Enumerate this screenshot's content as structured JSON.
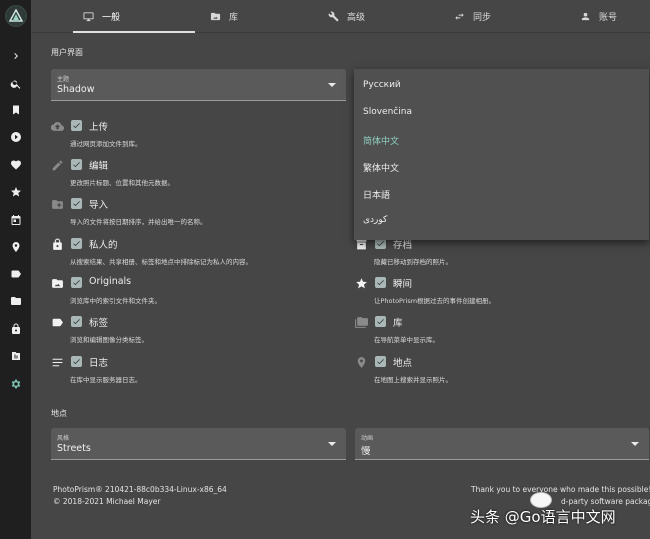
{
  "tabs": [
    {
      "label": "一般",
      "icon": "monitor-icon"
    },
    {
      "label": "库",
      "icon": "folder-image-icon"
    },
    {
      "label": "高级",
      "icon": "wrench-icon"
    },
    {
      "label": "同步",
      "icon": "sync-arrows-icon"
    },
    {
      "label": "账号",
      "icon": "person-icon"
    }
  ],
  "sections": {
    "ui": "用户界面",
    "places": "地点"
  },
  "theme_field": {
    "label": "主题",
    "value": "Shadow"
  },
  "language_options": [
    "Русский",
    "Slovenčina",
    "简体中文",
    "繁体中文",
    "日本語",
    "کوردی"
  ],
  "language_selected": "简体中文",
  "features_left": [
    {
      "label": "上传",
      "desc": "通过网页添加文件到库。",
      "icon": "cloud-upload-icon",
      "checked": true
    },
    {
      "label": "编辑",
      "desc": "更改照片标题、位置和其他元数据。",
      "icon": "pencil-icon",
      "checked": true
    },
    {
      "label": "导入",
      "desc": "导入的文件将按日期排序，并给出唯一的名称。",
      "icon": "folder-plus-icon",
      "checked": true
    },
    {
      "label": "私人的",
      "desc": "从搜索结果、共享相册、标签和地点中排除标记为私人的内容。",
      "icon": "lock-icon",
      "checked": true
    },
    {
      "label": "Originals",
      "desc": "浏览库中的索引文件和文件夹。",
      "icon": "folder-image-icon",
      "checked": true
    },
    {
      "label": "标签",
      "desc": "浏览和编辑图像分类标签。",
      "icon": "label-icon",
      "checked": true
    },
    {
      "label": "日志",
      "desc": "在库中显示服务器日志。",
      "icon": "list-lines-icon",
      "checked": true
    }
  ],
  "features_right": [
    {
      "label": "存档",
      "desc": "隐藏已移动到存档的照片。",
      "icon": "archive-icon",
      "checked": true
    },
    {
      "label": "瞬间",
      "desc": "让PhotoPrism根据过去的事件创建相册。",
      "icon": "star-icon",
      "checked": true
    },
    {
      "label": "库",
      "desc": "在导航菜单中显示库。",
      "icon": "folder-multiple-icon",
      "checked": true
    },
    {
      "label": "地点",
      "desc": "在地图上搜索并显示照片。",
      "icon": "map-pin-icon",
      "checked": true
    }
  ],
  "style_field": {
    "label": "风格",
    "value": "Streets"
  },
  "animation_field": {
    "label": "动画",
    "value": "慢"
  },
  "footer": {
    "version": "PhotoPrism® 210421-88c0b334-Linux-x86_64",
    "copyright": "© 2018-2021 Michael Mayer",
    "thanks": "Thank you to everyone who made this possible!",
    "third_party": "d-party software packages"
  },
  "watermark": "头条 @Go语言中文网",
  "nav_items": [
    "chevron-right-icon",
    "search-icon",
    "bookmark-icon",
    "play-circle-icon",
    "heart-icon",
    "star-icon",
    "calendar-icon",
    "map-pin-icon",
    "label-icon",
    "folder-icon",
    "lock-icon",
    "library-icon",
    "settings-icon"
  ],
  "colors": {
    "accent": "#8fd0c1",
    "nav_bg": "#1f1f1f",
    "page_bg": "#464646"
  }
}
